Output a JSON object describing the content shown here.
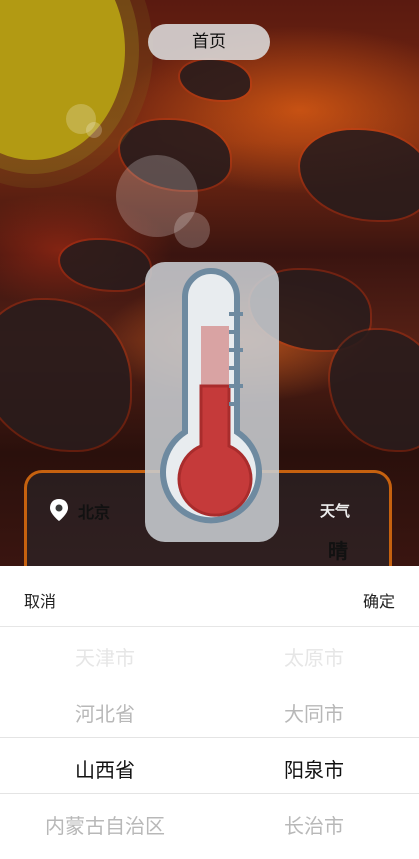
{
  "header": {
    "title": "首页"
  },
  "weather_card": {
    "city": "北京",
    "weather_label": "天气",
    "condition": "晴"
  },
  "picker": {
    "cancel_label": "取消",
    "confirm_label": "确定",
    "provinces": [
      "天津市",
      "河北省",
      "山西省",
      "内蒙古自治区"
    ],
    "cities": [
      "太原市",
      "大同市",
      "阳泉市",
      "长治市"
    ],
    "selected_province": "山西省",
    "selected_city": "阳泉市"
  },
  "colors": {
    "card_border": "#c6610f",
    "sun": "#b29a13",
    "thermometer_fill": "#c53a3a"
  },
  "icons": {
    "location": "map-pin-icon",
    "thermometer": "thermometer-icon"
  }
}
